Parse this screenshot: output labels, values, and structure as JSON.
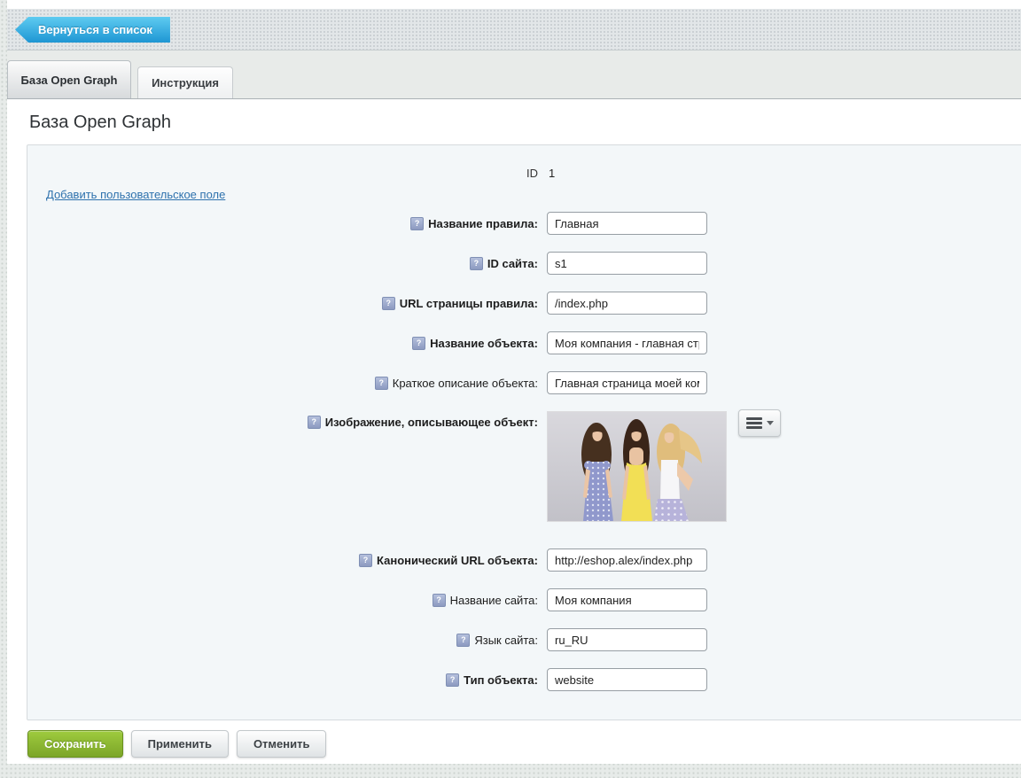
{
  "toolbar": {
    "back_button": "Вернуться в список"
  },
  "tabs": [
    {
      "label": "База Open Graph",
      "active": true
    },
    {
      "label": "Инструкция",
      "active": false
    }
  ],
  "page": {
    "title": "База Open Graph"
  },
  "form": {
    "id_label": "ID",
    "id_value": "1",
    "add_field_link": "Добавить пользовательское поле",
    "fields": [
      {
        "label": "Название правила",
        "value": "Главная",
        "bold": true
      },
      {
        "label": "ID сайта",
        "value": "s1",
        "bold": true
      },
      {
        "label": "URL страницы правила",
        "value": "/index.php",
        "bold": true
      },
      {
        "label": "Название объекта",
        "value": "Моя компания - главная стр",
        "bold": true
      },
      {
        "label": "Краткое описание объекта",
        "value": "Главная страница моей ком",
        "bold": false
      },
      {
        "label": "Изображение, описывающее объект",
        "type": "image",
        "bold": true
      },
      {
        "label": "Канонический URL объекта",
        "value": "http://eshop.alex/index.php",
        "bold": true
      },
      {
        "label": "Название сайта",
        "value": "Моя компания",
        "bold": false
      },
      {
        "label": "Язык сайта",
        "value": "ru_RU",
        "bold": false
      },
      {
        "label": "Тип объекта",
        "value": "website",
        "bold": true
      }
    ]
  },
  "buttons": {
    "save": "Сохранить",
    "apply": "Применить",
    "cancel": "Отменить"
  },
  "icons": {
    "help_glyph": "?",
    "back_arrow": "left-arrow",
    "menu": "hamburger-menu",
    "dropdown": "chevron-down"
  },
  "colors": {
    "accent_blue": "#29a3dc",
    "save_green": "#84ab27",
    "link_blue": "#2d71ad",
    "form_box_bg": "#f3f7f9",
    "toolbar_band": "#e2e6e8",
    "page_pattern": "#e7ebe9"
  }
}
